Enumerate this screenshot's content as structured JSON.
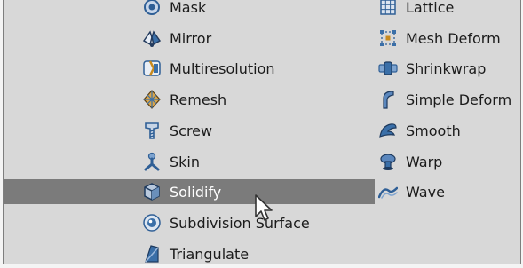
{
  "menu": {
    "left_items": [
      {
        "label": "Mask",
        "icon": "mask-icon"
      },
      {
        "label": "Mirror",
        "icon": "mirror-icon"
      },
      {
        "label": "Multiresolution",
        "icon": "multiresolution-icon"
      },
      {
        "label": "Remesh",
        "icon": "remesh-icon"
      },
      {
        "label": "Screw",
        "icon": "screw-icon"
      },
      {
        "label": "Skin",
        "icon": "skin-icon"
      },
      {
        "label": "Solidify",
        "icon": "solidify-icon",
        "selected": true
      },
      {
        "label": "Subdivision Surface",
        "icon": "subdivision-surface-icon"
      },
      {
        "label": "Triangulate",
        "icon": "triangulate-icon"
      }
    ],
    "right_items": [
      {
        "label": "Lattice",
        "icon": "lattice-icon"
      },
      {
        "label": "Mesh Deform",
        "icon": "mesh-deform-icon"
      },
      {
        "label": "Shrinkwrap",
        "icon": "shrinkwrap-icon"
      },
      {
        "label": "Simple Deform",
        "icon": "simple-deform-icon"
      },
      {
        "label": "Smooth",
        "icon": "smooth-icon"
      },
      {
        "label": "Warp",
        "icon": "warp-icon"
      },
      {
        "label": "Wave",
        "icon": "wave-icon"
      }
    ]
  },
  "colors": {
    "panel_background": "#d8d8d8",
    "selected_background": "#7b7b7b",
    "icon_blue": "#3a6fa8"
  },
  "cursor": "mouse-pointer-icon"
}
